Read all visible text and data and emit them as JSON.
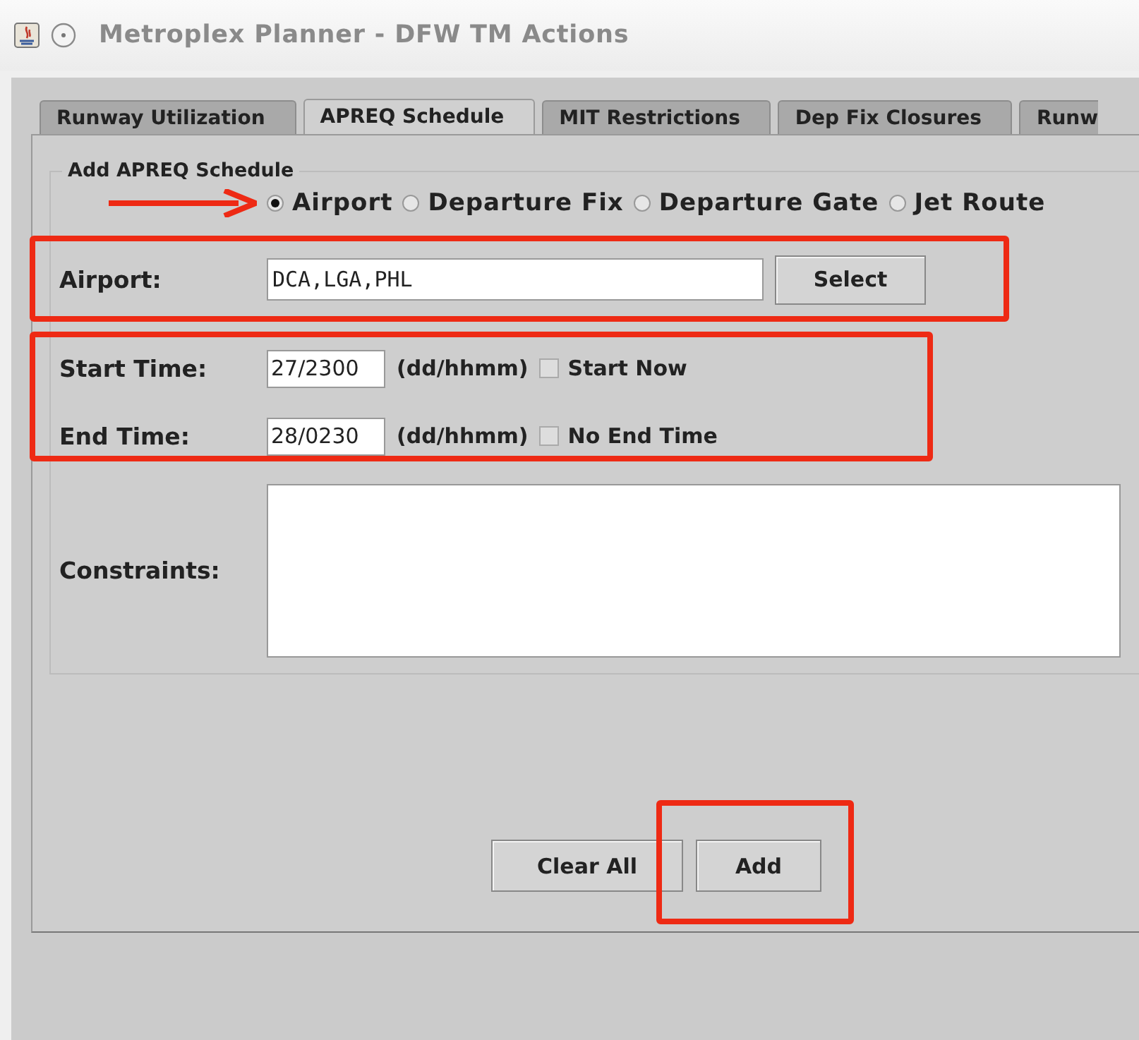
{
  "window": {
    "title": "Metroplex Planner - DFW TM Actions"
  },
  "tabs": [
    {
      "label": "Runway Utilization",
      "selected": false
    },
    {
      "label": "APREQ Schedule",
      "selected": true
    },
    {
      "label": "MIT Restrictions",
      "selected": false
    },
    {
      "label": "Dep Fix Closures",
      "selected": false
    },
    {
      "label": "Runw",
      "selected": false
    }
  ],
  "group": {
    "title": "Add APREQ Schedule"
  },
  "type_options": {
    "pointer_arrow": true,
    "options": [
      {
        "label": "Airport",
        "selected": true
      },
      {
        "label": "Departure Fix",
        "selected": false
      },
      {
        "label": "Departure Gate",
        "selected": false
      },
      {
        "label": "Jet Route",
        "selected": false
      }
    ]
  },
  "airport_row": {
    "label": "Airport:",
    "value": "DCA,LGA,PHL",
    "button": "Select",
    "highlighted": true
  },
  "time_rows": {
    "highlighted": true,
    "rows": [
      {
        "label": "Start Time:",
        "value": "27/2300",
        "hint": "(dd/hhmm)",
        "option": "Start Now",
        "checked": false
      },
      {
        "label": "End Time:",
        "value": "28/0230",
        "hint": "(dd/hhmm)",
        "option": "No End Time",
        "checked": false
      }
    ]
  },
  "constraints": {
    "label": "Constraints:"
  },
  "buttons": [
    {
      "label": "Clear All",
      "highlighted": false
    },
    {
      "label": "Add",
      "highlighted": true
    }
  ]
}
